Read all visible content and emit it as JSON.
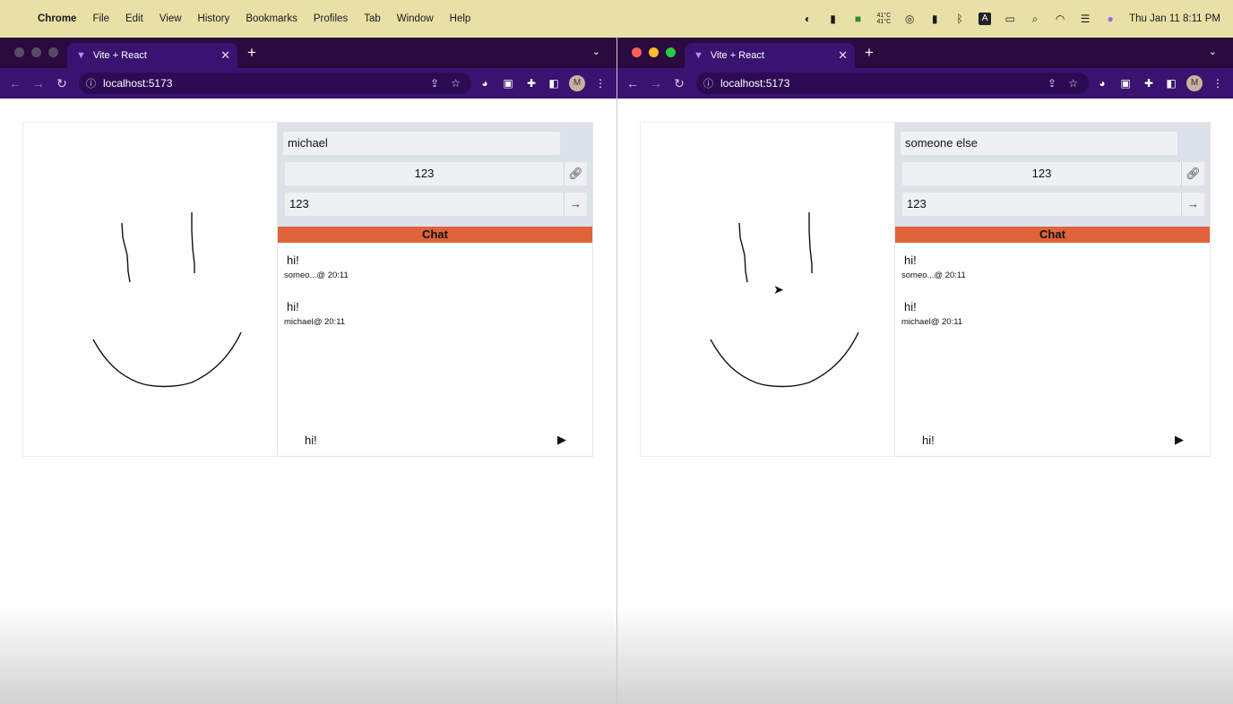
{
  "menubar": {
    "app": "Chrome",
    "items": [
      "File",
      "Edit",
      "View",
      "History",
      "Bookmarks",
      "Profiles",
      "Tab",
      "Window",
      "Help"
    ],
    "temp_top": "41°C",
    "temp_bottom": "41°C",
    "clock": "Thu Jan 11  8:11 PM"
  },
  "windows": [
    {
      "tab_title": "Vite + React",
      "url": "localhost:5173",
      "avatar": "M",
      "name": "michael",
      "room_id": "123",
      "room_join": "123",
      "chat_title": "Chat",
      "messages": [
        {
          "text": "hi!",
          "meta": "someo...@ 20:11"
        },
        {
          "text": "hi!",
          "meta": "michael@ 20:11"
        }
      ],
      "composer_value": "hi!"
    },
    {
      "tab_title": "Vite + React",
      "url": "localhost:5173",
      "avatar": "M",
      "name": "someone else",
      "room_id": "123",
      "room_join": "123",
      "chat_title": "Chat",
      "messages": [
        {
          "text": "hi!",
          "meta": "someo...@ 20:11"
        },
        {
          "text": "hi!",
          "meta": "michael@ 20:11"
        }
      ],
      "composer_value": "hi!"
    }
  ],
  "colors": {
    "menubar": "#e9e0a8",
    "tab_strip": "#2a0a3f",
    "toolbar": "#3a1270",
    "chat_header": "#e0633b",
    "control_panel": "#dde1e8"
  },
  "icons": {
    "copy_link": "link-icon",
    "join": "arrow-right-icon",
    "send": "play-triangle-icon"
  }
}
